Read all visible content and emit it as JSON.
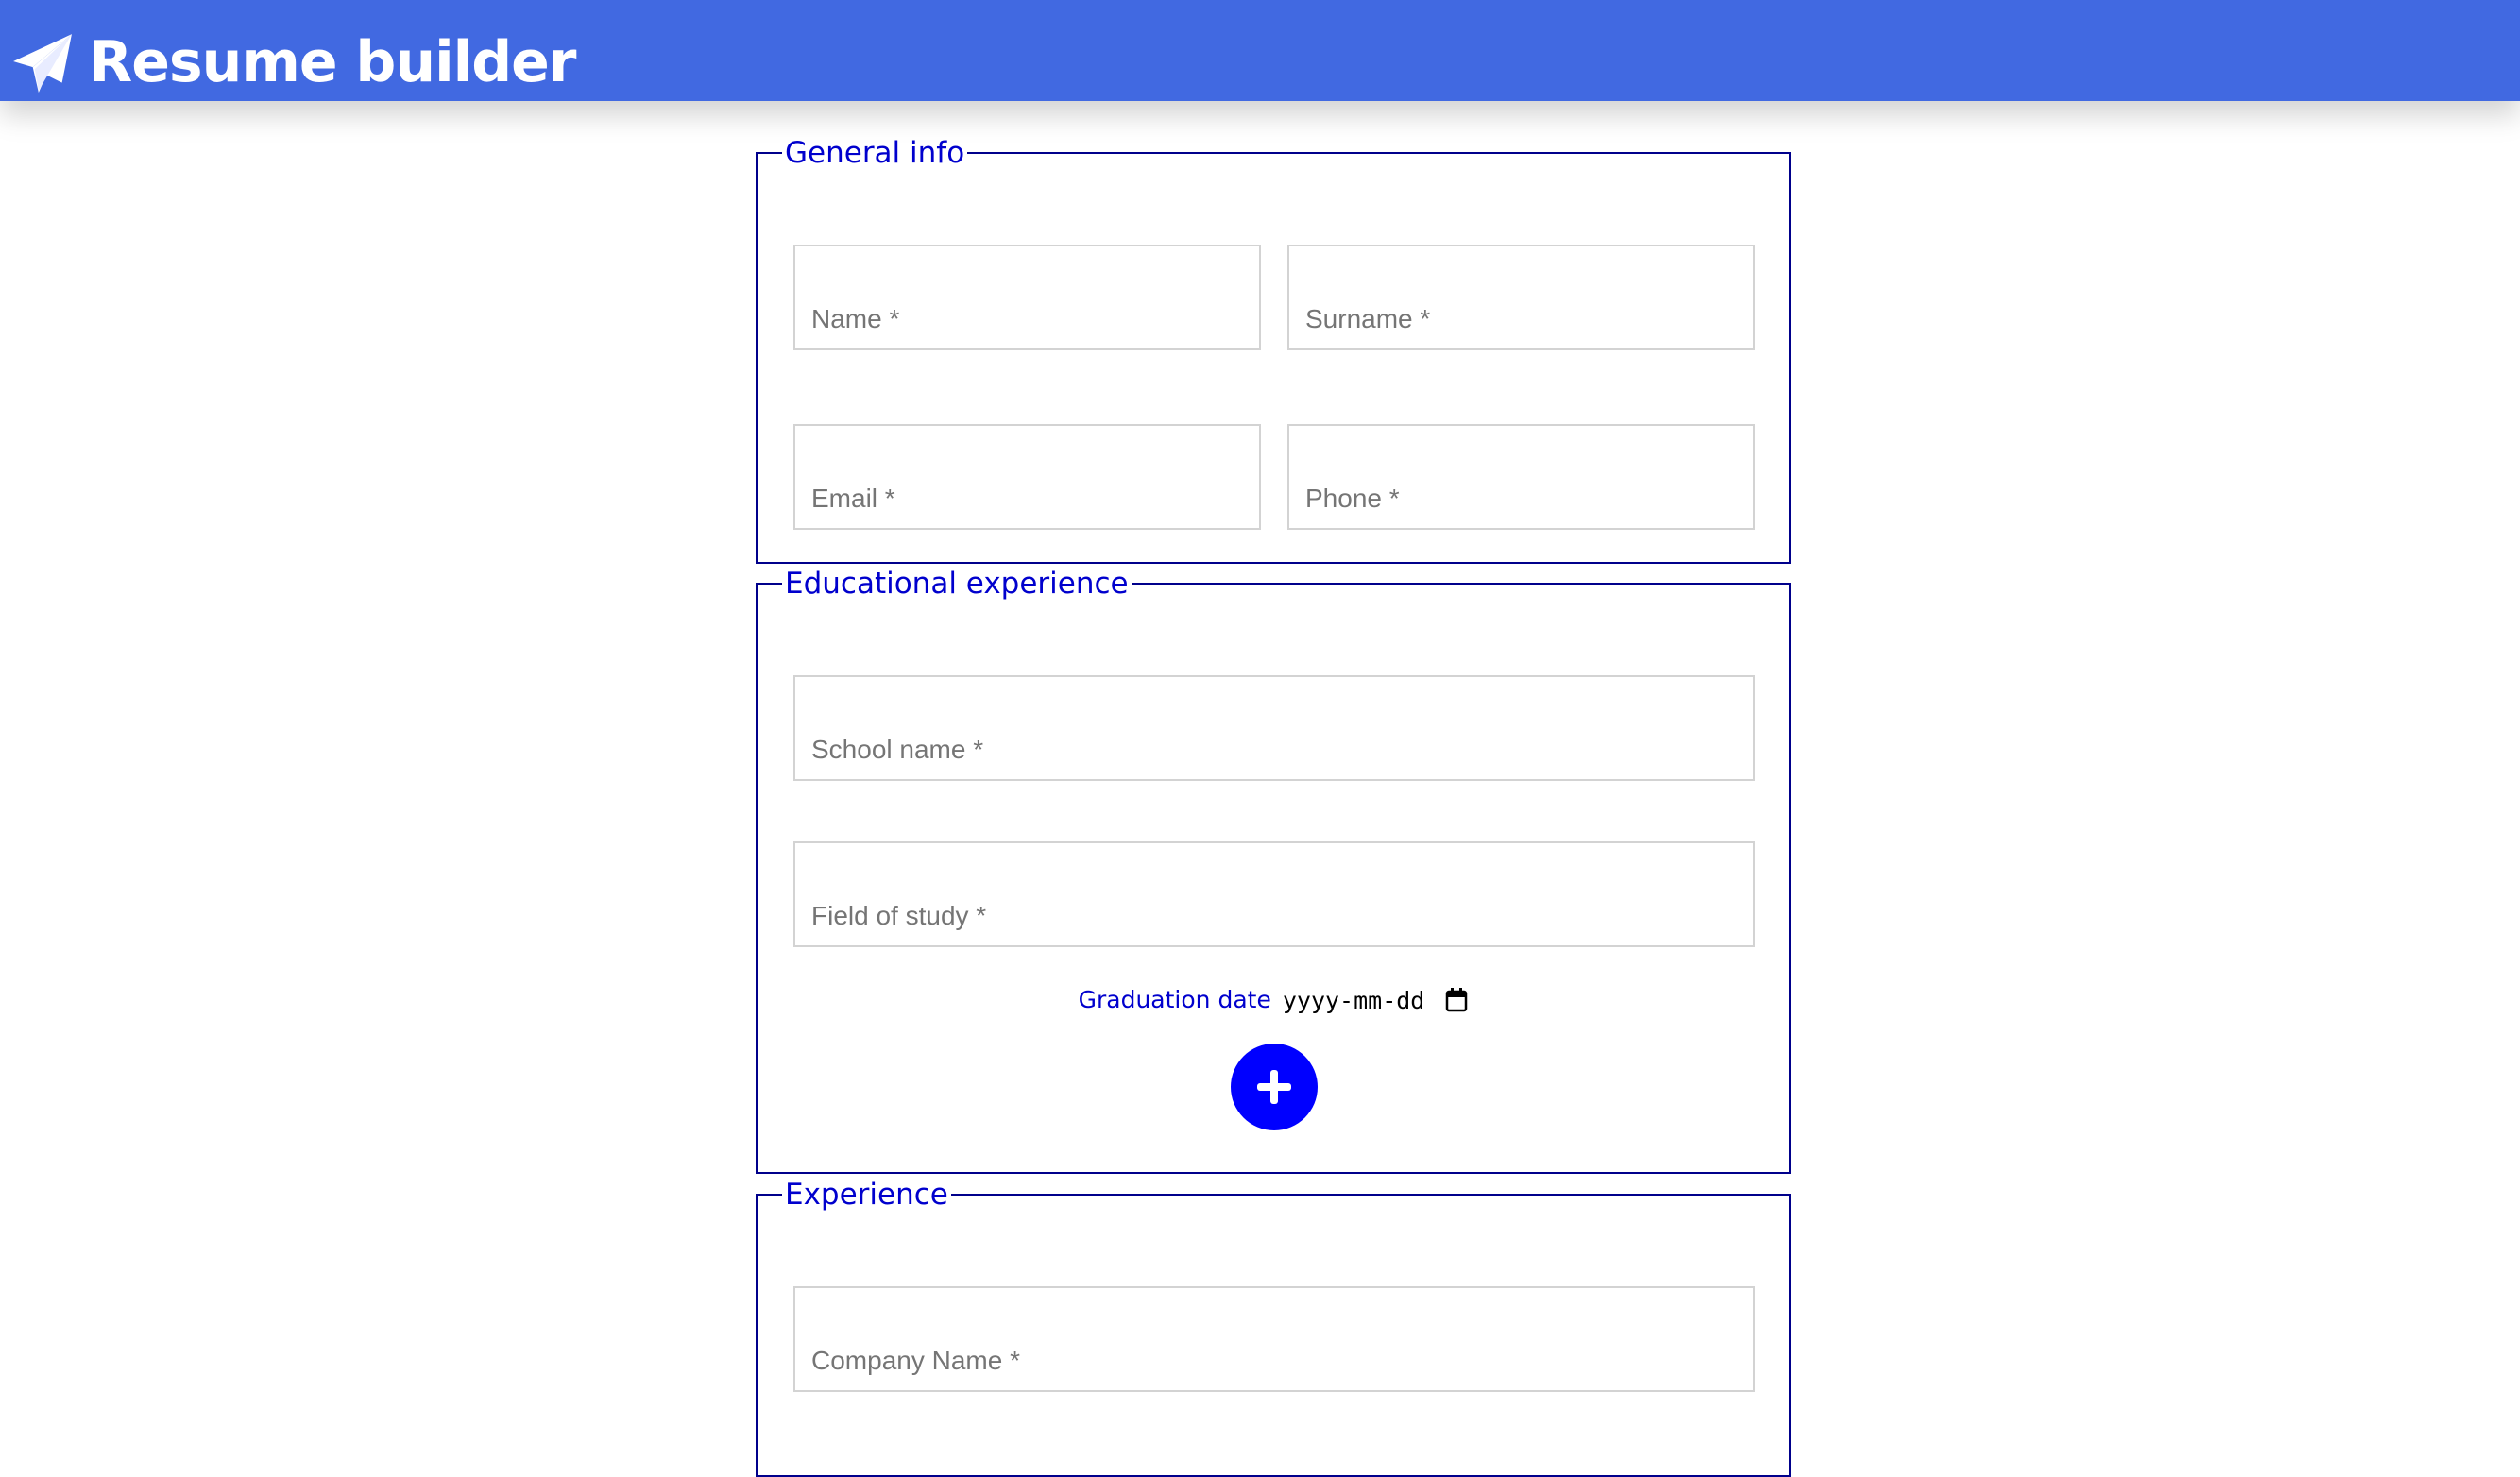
{
  "header": {
    "title": "Resume builder",
    "icon": "paper-plane-icon",
    "background_color": "#4169e1"
  },
  "general_info": {
    "legend": "General info",
    "fields": {
      "name": "Name *",
      "surname": "Surname *",
      "email": "Email *",
      "phone": "Phone *"
    }
  },
  "education": {
    "legend": "Educational experience",
    "fields": {
      "school_name": "School name *",
      "field_of_study": "Field of study *"
    },
    "graduation_label": "Graduation date",
    "date_placeholder": "yyyy-mm-dd",
    "add_button_icon": "plus-icon"
  },
  "experience": {
    "legend": "Experience",
    "fields": {
      "company_name": "Company Name *"
    }
  },
  "colors": {
    "border": "#00008b",
    "legend_text": "#0000cd",
    "add_button": "#0000ff",
    "input_border": "#d3d3d3",
    "placeholder": "#757575"
  }
}
